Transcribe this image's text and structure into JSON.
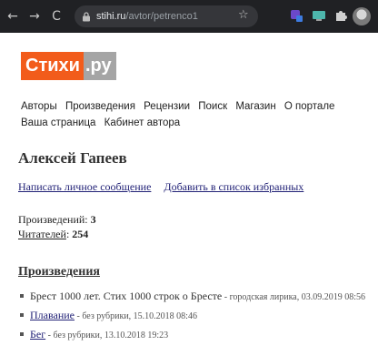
{
  "browser": {
    "url_host": "stihi.ru",
    "url_path": "/avtor/petrenco1",
    "back_icon": "←",
    "forward_icon": "→",
    "reload_icon": "C",
    "star_icon": "☆"
  },
  "logo": {
    "part1": "Стихи",
    "part2": ".ру"
  },
  "menu": {
    "items": [
      "Авторы",
      "Произведения",
      "Рецензии",
      "Поиск",
      "Магазин",
      "О портале",
      "Ваша страница",
      "Кабинет автора"
    ]
  },
  "author": {
    "name": "Алексей Гапеев"
  },
  "actions": {
    "message": "Написать личное сообщение",
    "favorites": "Добавить в список избранных"
  },
  "stats": {
    "works_label": "Произведений: ",
    "works_count": "3",
    "readers_label": "Читателей",
    "readers_sep": ": ",
    "readers_count": "254"
  },
  "works_section": {
    "title": "Произведения"
  },
  "works": [
    {
      "title": "Брест 1000 лет. Стих 1000 строк о Бресте",
      "sep": " - ",
      "meta": "городская лирика, 03.09.2019 08:56",
      "linked": false
    },
    {
      "title": "Плавание",
      "sep": " - ",
      "meta": "без рубрики, 15.10.2018 08:46",
      "linked": true
    },
    {
      "title": "Бег",
      "sep": " - ",
      "meta": "без рубрики, 13.10.2018 19:23",
      "linked": true
    }
  ]
}
